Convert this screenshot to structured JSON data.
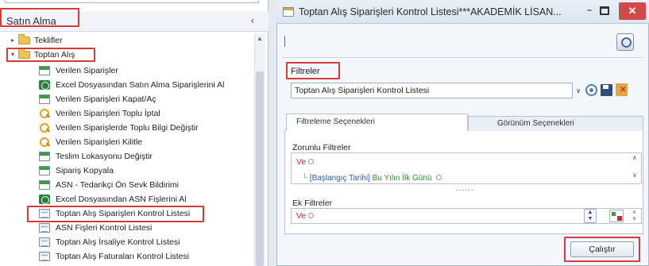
{
  "left_panel": {
    "title": "Satın Alma",
    "collapse_glyph": "‹",
    "tree": [
      {
        "label": "Teklifler",
        "icon": "folder-icon",
        "expander": "▸"
      },
      {
        "label": "Toptan Alış",
        "icon": "folder-icon",
        "expander": "▾"
      },
      {
        "label": "Verilen Siparişler",
        "icon": "form-green-icon"
      },
      {
        "label": "Excel Dosyasından Satın Alma Siparişlerini Al",
        "icon": "excel-icon"
      },
      {
        "label": "Verilen Siparişleri Kapat/Aç",
        "icon": "form-green-icon"
      },
      {
        "label": "Verilen Siparişleri Toplu İptal",
        "icon": "search-icon"
      },
      {
        "label": "Verilen Siparişlerde Toplu Bilgi Değiştir",
        "icon": "search-icon"
      },
      {
        "label": "Verilen Siparişleri Kilitle",
        "icon": "search-icon"
      },
      {
        "label": "Teslim Lokasyonu Değiştir",
        "icon": "form-green-icon"
      },
      {
        "label": "Sipariş Kopyala",
        "icon": "form-green-icon"
      },
      {
        "label": "ASN - Tedarikçi Ön Sevk Bildirimi",
        "icon": "form-green-icon"
      },
      {
        "label": "Excel Dosyasından ASN Fişlerini Al",
        "icon": "excel-icon"
      },
      {
        "label": "Toptan Alış Siparişleri Kontrol Listesi",
        "icon": "report-icon"
      },
      {
        "label": "ASN Fişleri Kontrol Listesi",
        "icon": "report-icon"
      },
      {
        "label": "Toptan Alış İrsaliye Kontrol Listesi",
        "icon": "report-icon"
      },
      {
        "label": "Toptan Alış Faturaları Kontrol Listesi",
        "icon": "report-icon"
      }
    ]
  },
  "window": {
    "title": "Toptan Alış Siparişleri Kontrol Listesi***AKADEMİK LİSAN...",
    "min_glyph": "–",
    "close_glyph": "✕",
    "filters_label": "Filtreler",
    "filter_selected": "Toptan Alış Siparişleri Kontrol Listesi",
    "dropdown_glyph": "∨",
    "tabs": [
      {
        "label": "Filtreleme Seçenekleri",
        "active": true
      },
      {
        "label": "Görünüm Seçenekleri",
        "active": false
      }
    ],
    "required_filters_label": "Zorunlu Filtreler",
    "required_root": "Ve",
    "required_condition_field": "[Başlangıç Tarihi]",
    "required_condition_op": "Bu Yılın İlk Günü",
    "tree_connector": "└",
    "dots": "......",
    "extra_filters_label": "Ek Filtreler",
    "extra_root": "Ve",
    "run_button": "Çalıştır"
  },
  "colors": {
    "highlight_box": "#d63b3b",
    "close_button": "#d04a4a",
    "operator_red": "#c0302c",
    "field_blue": "#2d5da1",
    "op_green": "#2d8a2d"
  }
}
